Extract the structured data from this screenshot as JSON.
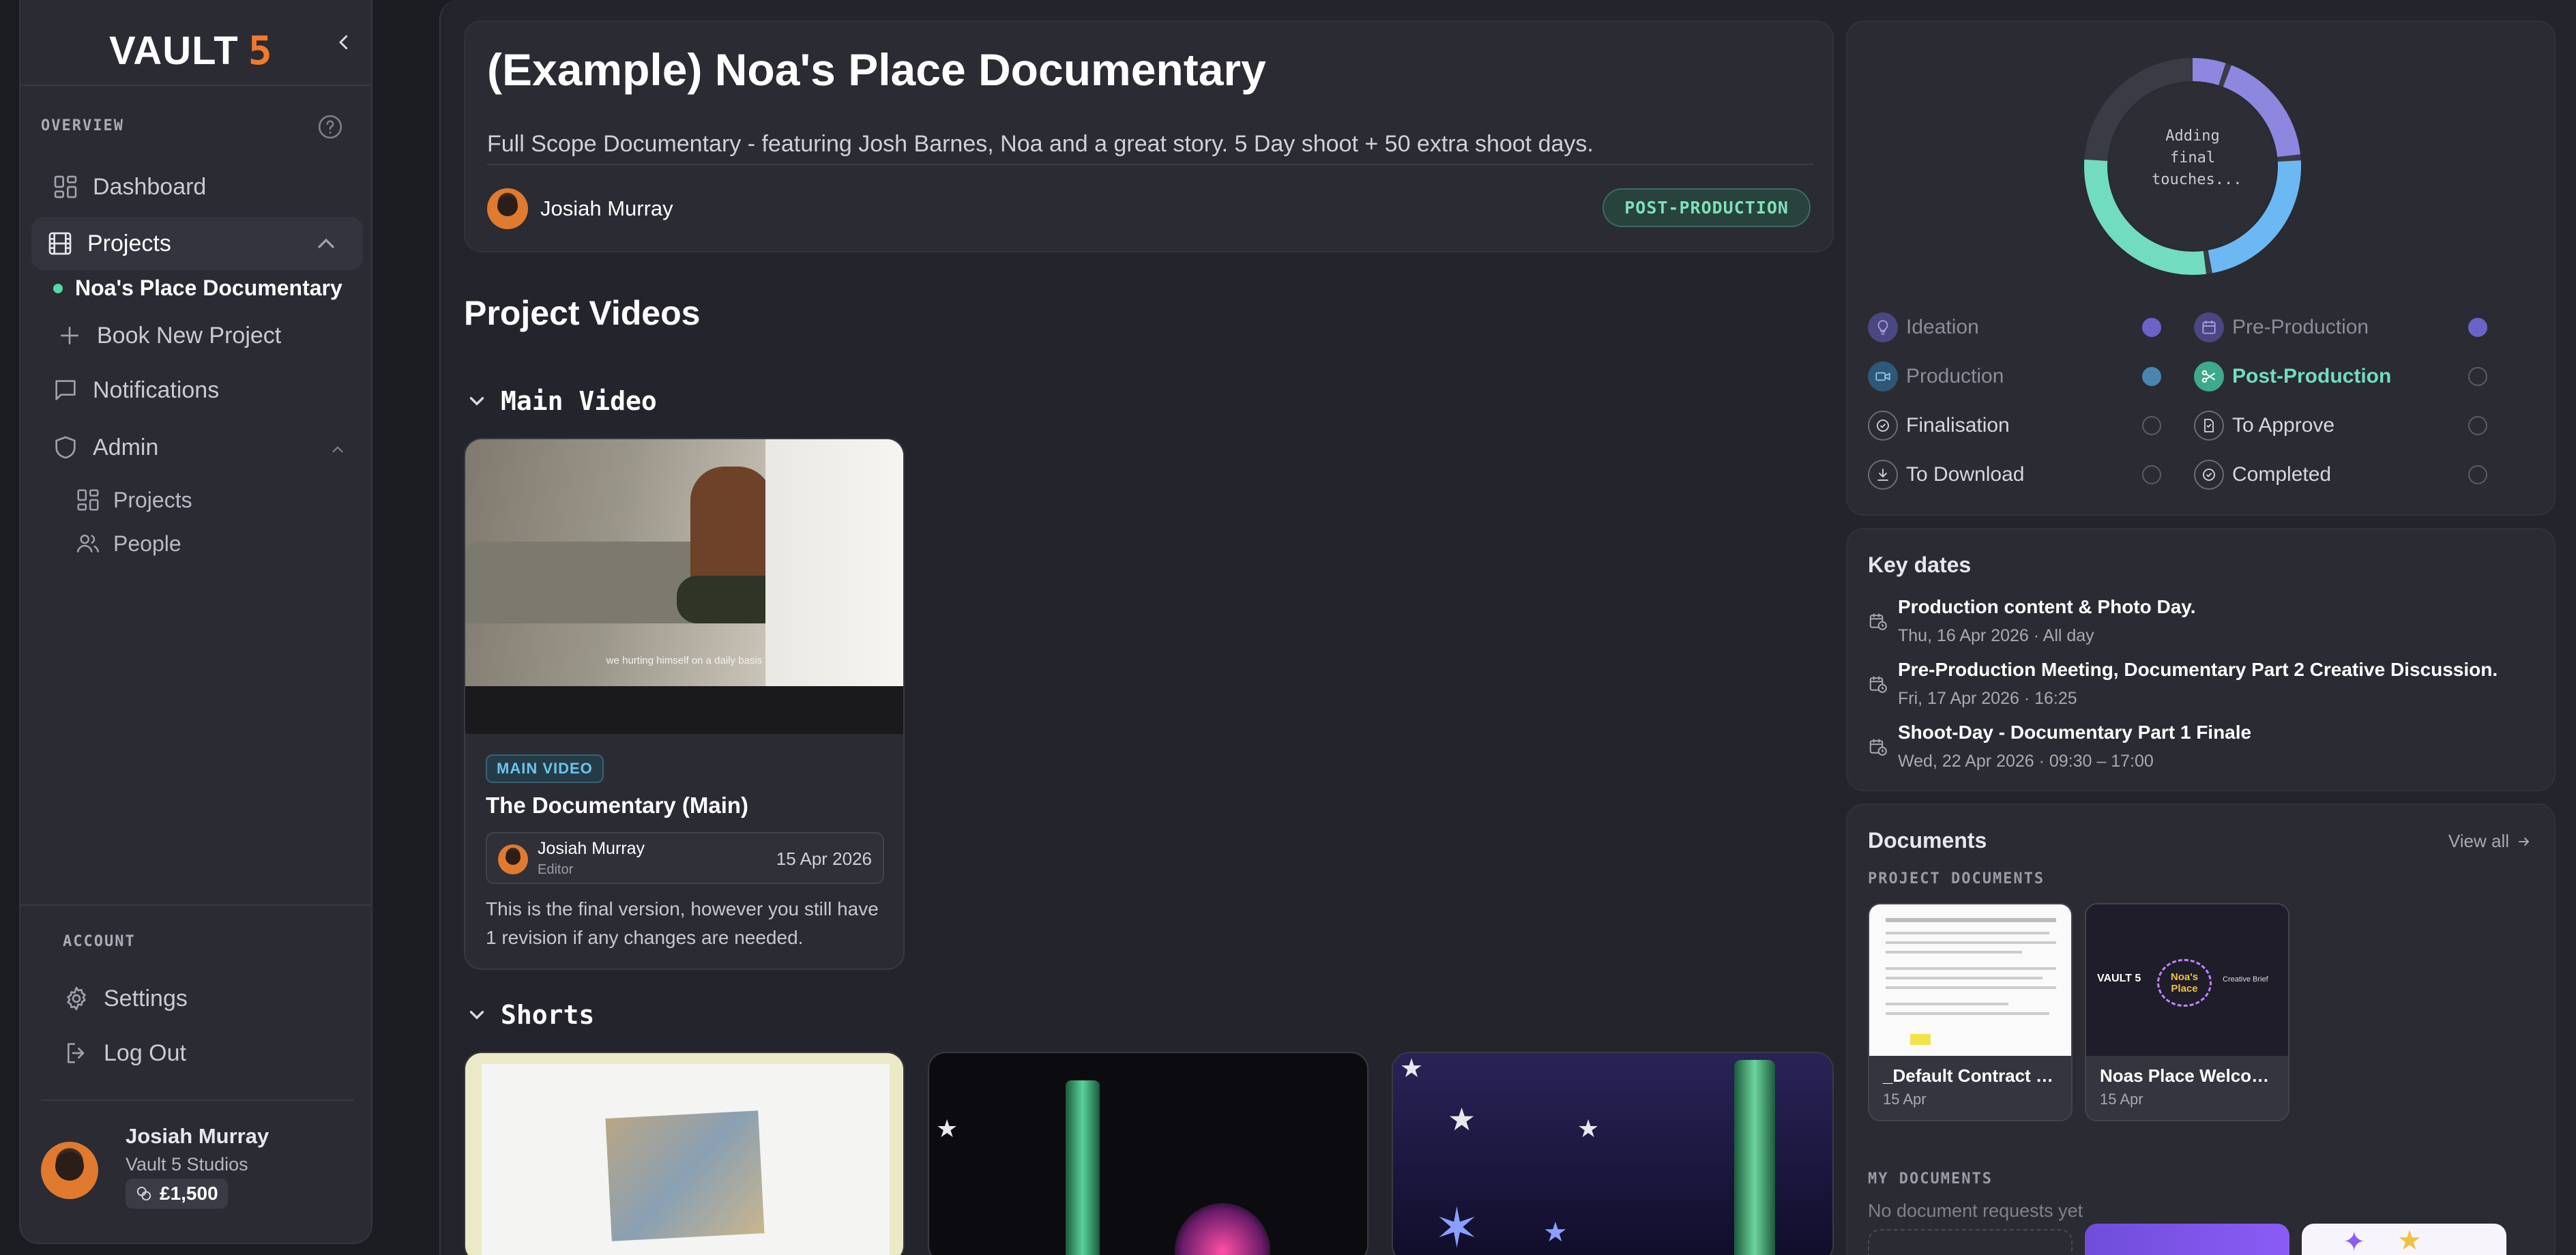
{
  "brand": {
    "name": "VAULT",
    "mark": "5"
  },
  "sidebar": {
    "overview_label": "OVERVIEW",
    "nav": {
      "dashboard": "Dashboard",
      "projects": "Projects",
      "current_project": "Noa's Place Documentary",
      "book_project": "Book New Project",
      "notifications": "Notifications",
      "admin": "Admin",
      "admin_projects": "Projects",
      "admin_people": "People"
    },
    "account_label": "ACCOUNT",
    "settings": "Settings",
    "logout": "Log Out",
    "user": {
      "name": "Josiah Murray",
      "company": "Vault 5 Studios",
      "credit": "£1,500"
    }
  },
  "project": {
    "title": "(Example) Noa's Place Documentary",
    "description": "Full Scope Documentary - featuring Josh Barnes, Noa and a great story. 5 Day shoot + 50 extra shoot days.",
    "owner": "Josiah Murray",
    "status": "POST-PRODUCTION"
  },
  "videos": {
    "section_title": "Project Videos",
    "main_group": "Main Video",
    "main_card": {
      "type": "MAIN VIDEO",
      "title": "The Documentary (Main)",
      "author": "Josiah Murray",
      "role": "Editor",
      "date": "15 Apr 2026",
      "note": "This is the final version, however you still have 1 revision if any changes are needed.",
      "subtitle": "we hurting himself on a daily basis"
    },
    "shorts_group": "Shorts"
  },
  "progress": {
    "center_text": [
      "Adding",
      "final",
      "touches..."
    ],
    "ring_colors": [
      "#8d87e0",
      "#6cb8f2",
      "#72dcc0",
      "#3a3b44"
    ],
    "stages": [
      {
        "label": "Ideation",
        "color": "#8d87e0",
        "done": true
      },
      {
        "label": "Pre-Production",
        "color": "#8d87e0",
        "done": true
      },
      {
        "label": "Production",
        "color": "#6cb8f2",
        "done": true
      },
      {
        "label": "Post-Production",
        "color": "#72dcc0",
        "done": false,
        "current": true
      },
      {
        "label": "Finalisation",
        "done": false
      },
      {
        "label": "To Approve",
        "done": false
      },
      {
        "label": "To Download",
        "done": false
      },
      {
        "label": "Completed",
        "done": false
      }
    ]
  },
  "key_dates": {
    "title": "Key dates",
    "items": [
      {
        "title": "Production content & Photo Day.",
        "when": "Thu, 16 Apr 2026 · All day"
      },
      {
        "title": "Pre-Production Meeting, Documentary Part 2 Creative Discussion.",
        "when": "Fri, 17 Apr 2026 · 16:25"
      },
      {
        "title": "Shoot-Day - Documentary Part 1 Finale",
        "when": "Wed, 22 Apr 2026 · 09:30 – 17:00"
      }
    ]
  },
  "documents": {
    "title": "Documents",
    "view_all": "View all",
    "project_docs_label": "PROJECT DOCUMENTS",
    "project_docs": [
      {
        "name": "_Default Contract Vi...",
        "date": "15 Apr"
      },
      {
        "name": "Noas Place Welcome",
        "date": "15 Apr"
      }
    ],
    "welcome_thumb": {
      "left": "VAULT 5",
      "logo_top": "Noa's",
      "logo_bottom": "Place",
      "right": "Creative Brief"
    },
    "my_docs_label": "MY DOCUMENTS",
    "my_docs_empty": "No document requests yet"
  }
}
